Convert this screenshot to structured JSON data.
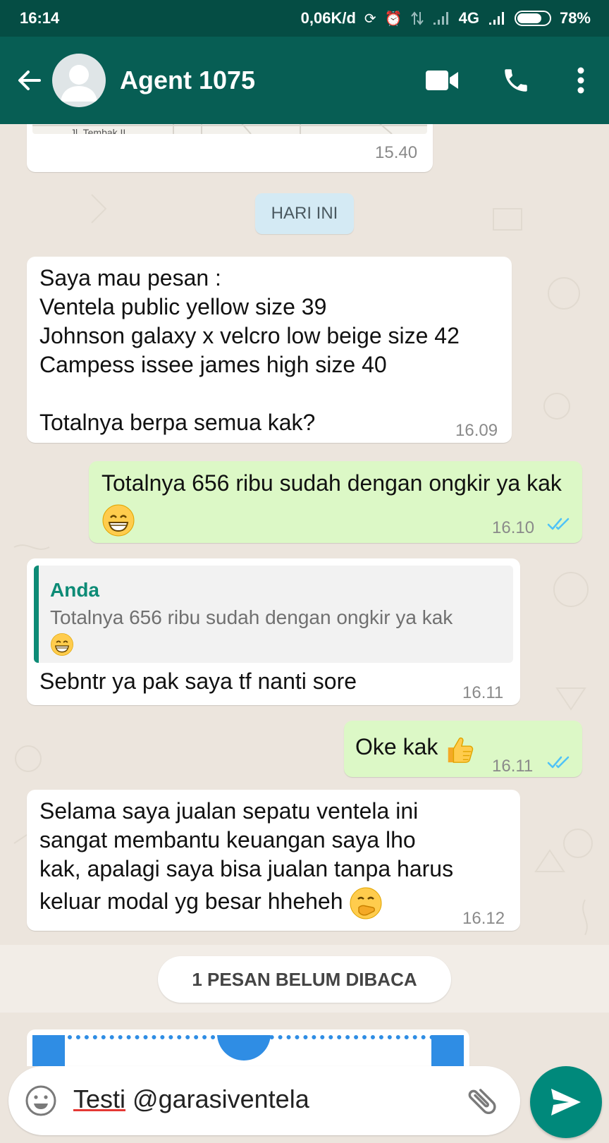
{
  "status_bar": {
    "time": "16:14",
    "network_speed": "0,06K/d",
    "network_type": "4G",
    "battery": "78%",
    "battery_level": 0.78
  },
  "header": {
    "contact_name": "Agent 1075",
    "icons": [
      "back-arrow-icon",
      "avatar",
      "video-call-icon",
      "phone-icon",
      "more-vert-icon"
    ]
  },
  "chat": {
    "map_bubble": {
      "street_label": "Jl. Tembak II",
      "time": "15.40"
    },
    "day_divider": "HARI INI",
    "messages": [
      {
        "direction": "in",
        "lines": [
          "Saya mau pesan :",
          "Ventela public yellow size 39",
          "Johnson galaxy x velcro low beige size 42",
          "Campess issee james high size 40",
          "",
          "Totalnya berpa semua kak?"
        ],
        "time": "16.09"
      },
      {
        "direction": "out",
        "text": "Totalnya 656 ribu sudah dengan ongkir ya kak",
        "emoji": "grinning-face",
        "time": "16.10",
        "status": "read"
      },
      {
        "direction": "in",
        "quote_author": "Anda",
        "quote_text": "Totalnya 656 ribu sudah dengan ongkir ya kak",
        "text": "Sebntr ya pak saya tf nanti sore",
        "time": "16.11"
      },
      {
        "direction": "out",
        "text": "Oke kak",
        "emoji": "thumbs-up",
        "time": "16.11",
        "status": "read"
      },
      {
        "direction": "in",
        "lines": [
          "Selama saya jualan sepatu ventela ini",
          "sangat membantu keuangan saya lho",
          "kak, apalagi saya bisa jualan tanpa harus",
          "keluar modal yg besar hheheh"
        ],
        "emoji": "face-with-hand-over-mouth",
        "time": "16.12"
      }
    ],
    "unread_divider": "1 PESAN BELUM DIBACA"
  },
  "composer": {
    "word1": "Testi",
    "word2": " @garasiventela"
  },
  "colors": {
    "status_bar": "#054d44",
    "app_bar": "#075e54",
    "chat_bg": "#ece5dd",
    "outgoing_bubble": "#dcf8c6",
    "incoming_bubble": "#ffffff",
    "read_ticks": "#4fc3f7",
    "send_button": "#00897b"
  }
}
